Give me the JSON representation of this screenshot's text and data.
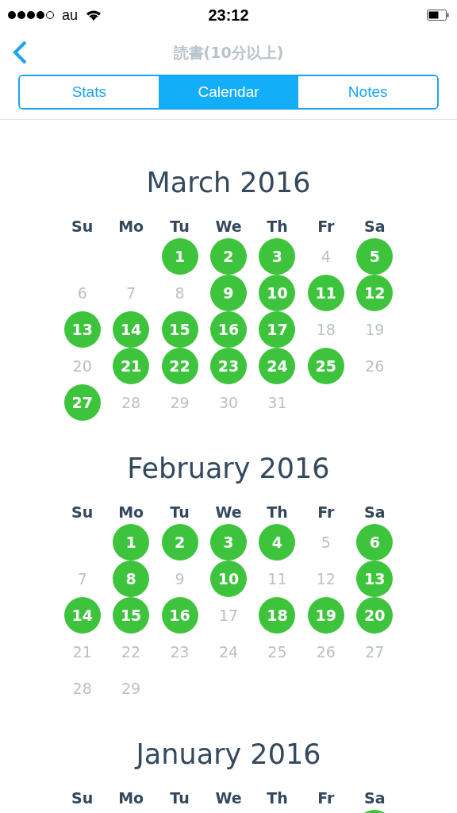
{
  "status_bar": {
    "carrier": "au",
    "time": "23:12"
  },
  "nav": {
    "title": "読書(10分以上)"
  },
  "tabs": [
    {
      "label": "Stats",
      "selected": false
    },
    {
      "label": "Calendar",
      "selected": true
    },
    {
      "label": "Notes",
      "selected": false
    }
  ],
  "months": [
    {
      "title": "March 2016",
      "weekdays": [
        "Su",
        "Mo",
        "Tu",
        "We",
        "Th",
        "Fr",
        "Sa"
      ],
      "weeks": [
        [
          {
            "kind": "blank"
          },
          {
            "kind": "blank"
          },
          {
            "kind": "day",
            "label": "1",
            "done": true
          },
          {
            "kind": "day",
            "label": "2",
            "done": true
          },
          {
            "kind": "day",
            "label": "3",
            "done": true
          },
          {
            "kind": "day",
            "label": "4",
            "done": false
          },
          {
            "kind": "day",
            "label": "5",
            "done": true
          }
        ],
        [
          {
            "kind": "day",
            "label": "6",
            "done": false
          },
          {
            "kind": "day",
            "label": "7",
            "done": false
          },
          {
            "kind": "day",
            "label": "8",
            "done": false
          },
          {
            "kind": "day",
            "label": "9",
            "done": true
          },
          {
            "kind": "day",
            "label": "10",
            "done": true
          },
          {
            "kind": "day",
            "label": "11",
            "done": true
          },
          {
            "kind": "day",
            "label": "12",
            "done": true
          }
        ],
        [
          {
            "kind": "day",
            "label": "13",
            "done": true
          },
          {
            "kind": "day",
            "label": "14",
            "done": true
          },
          {
            "kind": "day",
            "label": "15",
            "done": true
          },
          {
            "kind": "day",
            "label": "16",
            "done": true
          },
          {
            "kind": "day",
            "label": "17",
            "done": true
          },
          {
            "kind": "day",
            "label": "18",
            "done": false
          },
          {
            "kind": "day",
            "label": "19",
            "done": false
          }
        ],
        [
          {
            "kind": "day",
            "label": "20",
            "done": false
          },
          {
            "kind": "day",
            "label": "21",
            "done": true
          },
          {
            "kind": "day",
            "label": "22",
            "done": true
          },
          {
            "kind": "day",
            "label": "23",
            "done": true
          },
          {
            "kind": "day",
            "label": "24",
            "done": true
          },
          {
            "kind": "day",
            "label": "25",
            "done": true
          },
          {
            "kind": "day",
            "label": "26",
            "done": false
          }
        ],
        [
          {
            "kind": "day",
            "label": "27",
            "done": true
          },
          {
            "kind": "day",
            "label": "28",
            "done": false
          },
          {
            "kind": "day",
            "label": "29",
            "done": false
          },
          {
            "kind": "day",
            "label": "30",
            "done": false
          },
          {
            "kind": "day",
            "label": "31",
            "done": false
          }
        ]
      ]
    },
    {
      "title": "February 2016",
      "weekdays": [
        "Su",
        "Mo",
        "Tu",
        "We",
        "Th",
        "Fr",
        "Sa"
      ],
      "weeks": [
        [
          {
            "kind": "blank"
          },
          {
            "kind": "day",
            "label": "1",
            "done": true
          },
          {
            "kind": "day",
            "label": "2",
            "done": true
          },
          {
            "kind": "day",
            "label": "3",
            "done": true
          },
          {
            "kind": "day",
            "label": "4",
            "done": true
          },
          {
            "kind": "day",
            "label": "5",
            "done": false
          },
          {
            "kind": "day",
            "label": "6",
            "done": true
          }
        ],
        [
          {
            "kind": "day",
            "label": "7",
            "done": false
          },
          {
            "kind": "day",
            "label": "8",
            "done": true
          },
          {
            "kind": "day",
            "label": "9",
            "done": false
          },
          {
            "kind": "day",
            "label": "10",
            "done": true
          },
          {
            "kind": "day",
            "label": "11",
            "done": false
          },
          {
            "kind": "day",
            "label": "12",
            "done": false
          },
          {
            "kind": "day",
            "label": "13",
            "done": true
          }
        ],
        [
          {
            "kind": "day",
            "label": "14",
            "done": true
          },
          {
            "kind": "day",
            "label": "15",
            "done": true
          },
          {
            "kind": "day",
            "label": "16",
            "done": true
          },
          {
            "kind": "day",
            "label": "17",
            "done": false
          },
          {
            "kind": "day",
            "label": "18",
            "done": true
          },
          {
            "kind": "day",
            "label": "19",
            "done": true
          },
          {
            "kind": "day",
            "label": "20",
            "done": true
          }
        ],
        [
          {
            "kind": "day",
            "label": "21",
            "done": false
          },
          {
            "kind": "day",
            "label": "22",
            "done": false
          },
          {
            "kind": "day",
            "label": "23",
            "done": false
          },
          {
            "kind": "day",
            "label": "24",
            "done": false
          },
          {
            "kind": "day",
            "label": "25",
            "done": false
          },
          {
            "kind": "day",
            "label": "26",
            "done": false
          },
          {
            "kind": "day",
            "label": "27",
            "done": false
          }
        ],
        [
          {
            "kind": "day",
            "label": "28",
            "done": false
          },
          {
            "kind": "day",
            "label": "29",
            "done": false
          }
        ]
      ]
    },
    {
      "title": "January 2016",
      "weekdays": [
        "Su",
        "Mo",
        "Tu",
        "We",
        "Th",
        "Fr",
        "Sa"
      ],
      "weeks": [
        [
          {
            "kind": "blank"
          },
          {
            "kind": "blank"
          },
          {
            "kind": "blank"
          },
          {
            "kind": "blank"
          },
          {
            "kind": "blank"
          },
          {
            "kind": "blank"
          },
          {
            "kind": "day",
            "done": true
          }
        ]
      ]
    }
  ]
}
